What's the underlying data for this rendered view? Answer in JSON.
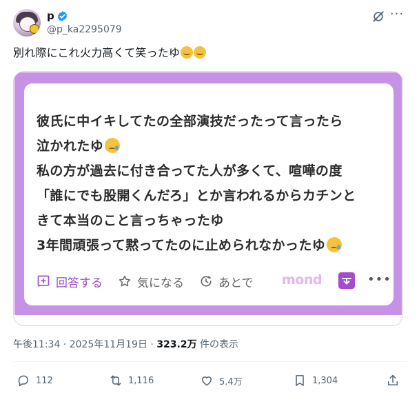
{
  "header": {
    "display_name": "p",
    "handle": "@p_ka2295079"
  },
  "tweet": {
    "text": "別れ際にこれ火力高くて笑ったゆ"
  },
  "card": {
    "lines": [
      "彼氏に中イキしてたの全部演技だったって言ったら",
      "泣かれたゆ",
      "私の方が過去に付き合ってた人が多くて、喧嘩の度",
      "「誰にでも股開くんだろ」とか言われるからカチンと",
      "きて本当のこと言っちゃったゆ",
      "3年間頑張って黙ってたのに止められなかったゆ"
    ],
    "answer_label": "回答する",
    "like_label": "気になる",
    "later_label": "あとで",
    "brand": "mond"
  },
  "meta": {
    "time": "午後11:34 · 2025年11月19日 · ",
    "views": "323.2万",
    "views_suffix": " 件の表示"
  },
  "actions": {
    "replies": "112",
    "retweets": "1,116",
    "likes": "5.4万",
    "bookmarks": "1,304"
  },
  "colors": {
    "frame": "#c792e6",
    "accent": "#9b4fc7",
    "verified": "#1d9bf0"
  },
  "icons": [
    "verified-badge-icon",
    "grok-icon",
    "more-icon",
    "answer-icon",
    "star-icon",
    "clock-icon",
    "save-icon",
    "reply-icon",
    "retweet-icon",
    "heart-icon",
    "bookmark-icon",
    "share-icon"
  ]
}
